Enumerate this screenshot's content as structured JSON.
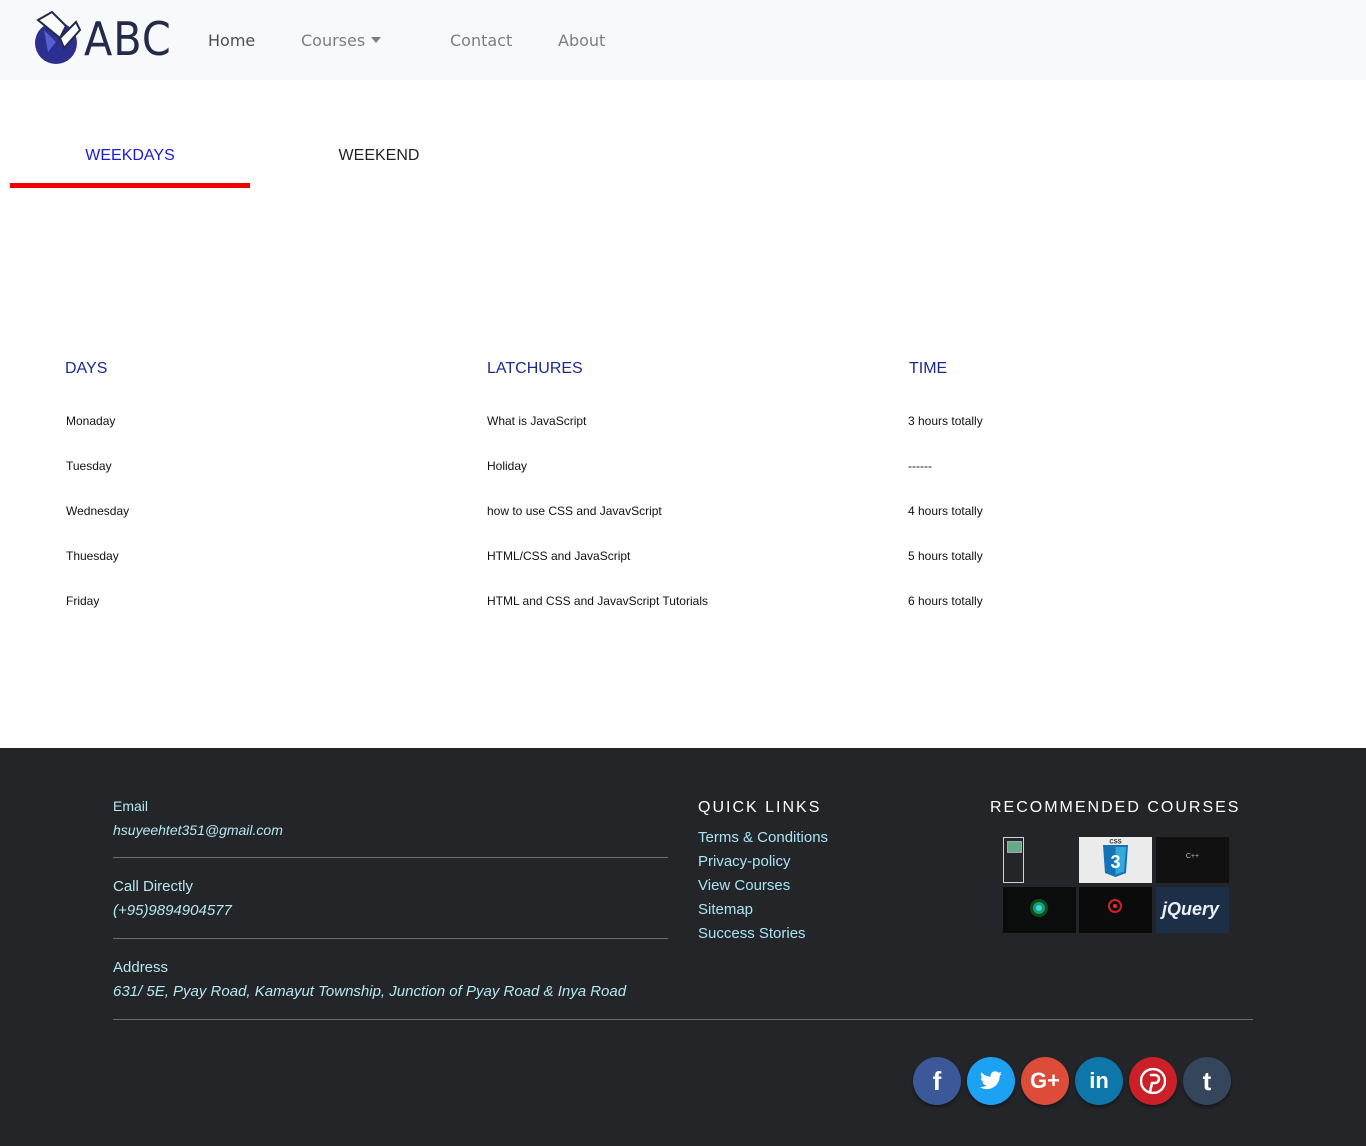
{
  "navbar": {
    "logo_text": "ABC",
    "links": [
      {
        "label": "Home"
      },
      {
        "label": "Courses"
      },
      {
        "label": "Contact"
      },
      {
        "label": "About"
      }
    ]
  },
  "tabs": [
    {
      "label": "WEEKDAYS",
      "active": true
    },
    {
      "label": "WEEKEND",
      "active": false
    }
  ],
  "schedule": {
    "headers": [
      "DAYS",
      "LATCHURES",
      "TIME"
    ],
    "rows": [
      {
        "day": "Monaday",
        "lecture": "What is JavaScript",
        "time": "3 hours totally"
      },
      {
        "day": "Tuesday",
        "lecture": "Holiday",
        "time": "------"
      },
      {
        "day": "Wednesday",
        "lecture": "how to use CSS and JavavScript",
        "time": "4 hours totally"
      },
      {
        "day": "Thuesday",
        "lecture": "HTML/CSS and JavaScript",
        "time": "5 hours totally"
      },
      {
        "day": "Friday",
        "lecture": "HTML and CSS and JavavScript Tutorials",
        "time": "6 hours totally"
      }
    ]
  },
  "footer": {
    "contact": {
      "email_label": "Email",
      "email": "hsuyeehtet351@gmail.com",
      "phone_label": "Call Directly",
      "phone": "(+95)9894904577",
      "address_label": "Address",
      "address": "631/ 5E, Pyay Road, Kamayut Township, Junction of Pyay Road & Inya Road"
    },
    "quick_links": {
      "heading": "QUICK LINKS",
      "items": [
        "Terms & Conditions",
        "Privacy-policy",
        "View Courses",
        "Sitemap",
        "Success Stories"
      ]
    },
    "recommended": {
      "heading": "RECOMMENDED COURSES",
      "css_label": "CSS",
      "css_number": "3",
      "cpp_label": "C++",
      "jquery_label": "jQuery"
    },
    "social": [
      {
        "icon": "facebook-icon",
        "glyph": "f",
        "color": "#3b5998"
      },
      {
        "icon": "twitter-icon",
        "glyph": "t",
        "color": "#1da1f2"
      },
      {
        "icon": "google-plus-icon",
        "glyph": "G+",
        "color": "#dd4b39"
      },
      {
        "icon": "linkedin-icon",
        "glyph": "in",
        "color": "#0e76a8"
      },
      {
        "icon": "pinterest-icon",
        "glyph": "P",
        "color": "#cb2027"
      },
      {
        "icon": "tumblr-icon",
        "glyph": "t",
        "color": "#35465c"
      }
    ]
  }
}
